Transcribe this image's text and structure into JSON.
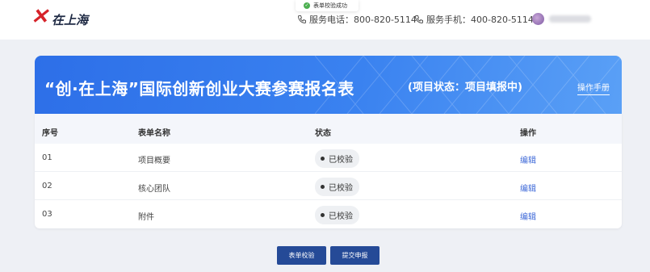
{
  "header": {
    "logo_text": "在上海",
    "logo_mark": "创",
    "hotline": "服务电话：800-820-5114",
    "mobile": "服务手机：400-820-5114",
    "phone_icon": "phone-icon",
    "avatar_icon": "user-avatar"
  },
  "toast": {
    "message": "表单校验成功",
    "icon": "check-circle-icon",
    "check": "✓"
  },
  "banner": {
    "title": "“创·在上海”国际创新创业大赛参赛报名表",
    "status": "(项目状态：项目填报中)",
    "manual_link": "操作手册"
  },
  "table": {
    "headers": [
      "序号",
      "表单名称",
      "状态",
      "操作"
    ],
    "rows": [
      {
        "index": "01",
        "name": "项目概要",
        "status": "已校验",
        "action": "编辑"
      },
      {
        "index": "02",
        "name": "核心团队",
        "status": "已校验",
        "action": "编辑"
      },
      {
        "index": "03",
        "name": "附件",
        "status": "已校验",
        "action": "编辑"
      }
    ]
  },
  "buttons": {
    "validate": "表单校验",
    "submit": "提交申报"
  },
  "colors": {
    "banner": "#3a82f0",
    "button": "#254a97",
    "link": "#3f6ad8",
    "success": "#4caf50"
  }
}
